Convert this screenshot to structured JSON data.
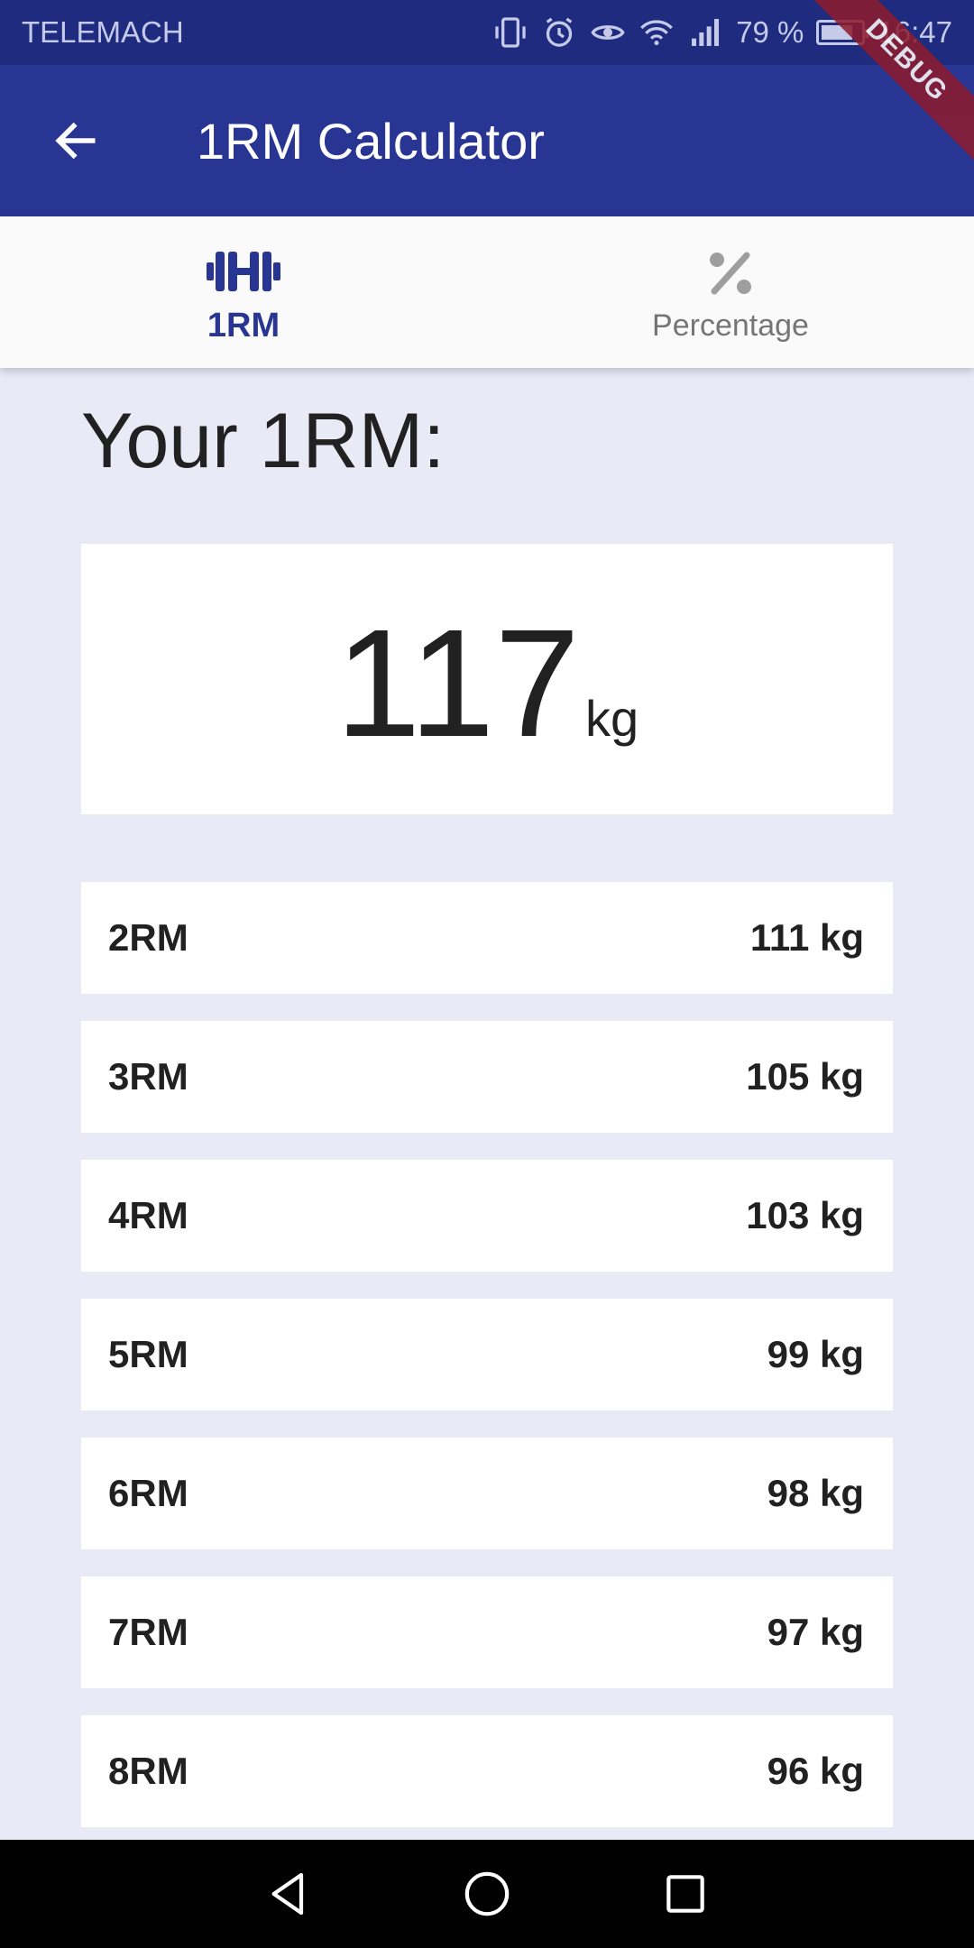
{
  "status_bar": {
    "carrier": "TELEMACH",
    "battery": "79 %",
    "time": "16:47",
    "battery_level": 0.79
  },
  "app_bar": {
    "title": "1RM Calculator",
    "debug_banner": "DEBUG",
    "color": "#283593"
  },
  "tabs": [
    {
      "label": "1RM",
      "icon": "barbell-icon",
      "active": true
    },
    {
      "label": "Percentage",
      "icon": "percent-icon",
      "active": false
    }
  ],
  "main": {
    "heading": "Your 1RM:",
    "result_value": "117",
    "result_unit": "kg",
    "reps": [
      {
        "label": "2RM",
        "value": "111 kg"
      },
      {
        "label": "3RM",
        "value": "105 kg"
      },
      {
        "label": "4RM",
        "value": "103 kg"
      },
      {
        "label": "5RM",
        "value": "99 kg"
      },
      {
        "label": "6RM",
        "value": "98 kg"
      },
      {
        "label": "7RM",
        "value": "97 kg"
      },
      {
        "label": "8RM",
        "value": "96 kg"
      }
    ]
  },
  "colors": {
    "primary": "#283593",
    "status_bar": "#1f2b7e",
    "background": "#e8eaf6"
  }
}
